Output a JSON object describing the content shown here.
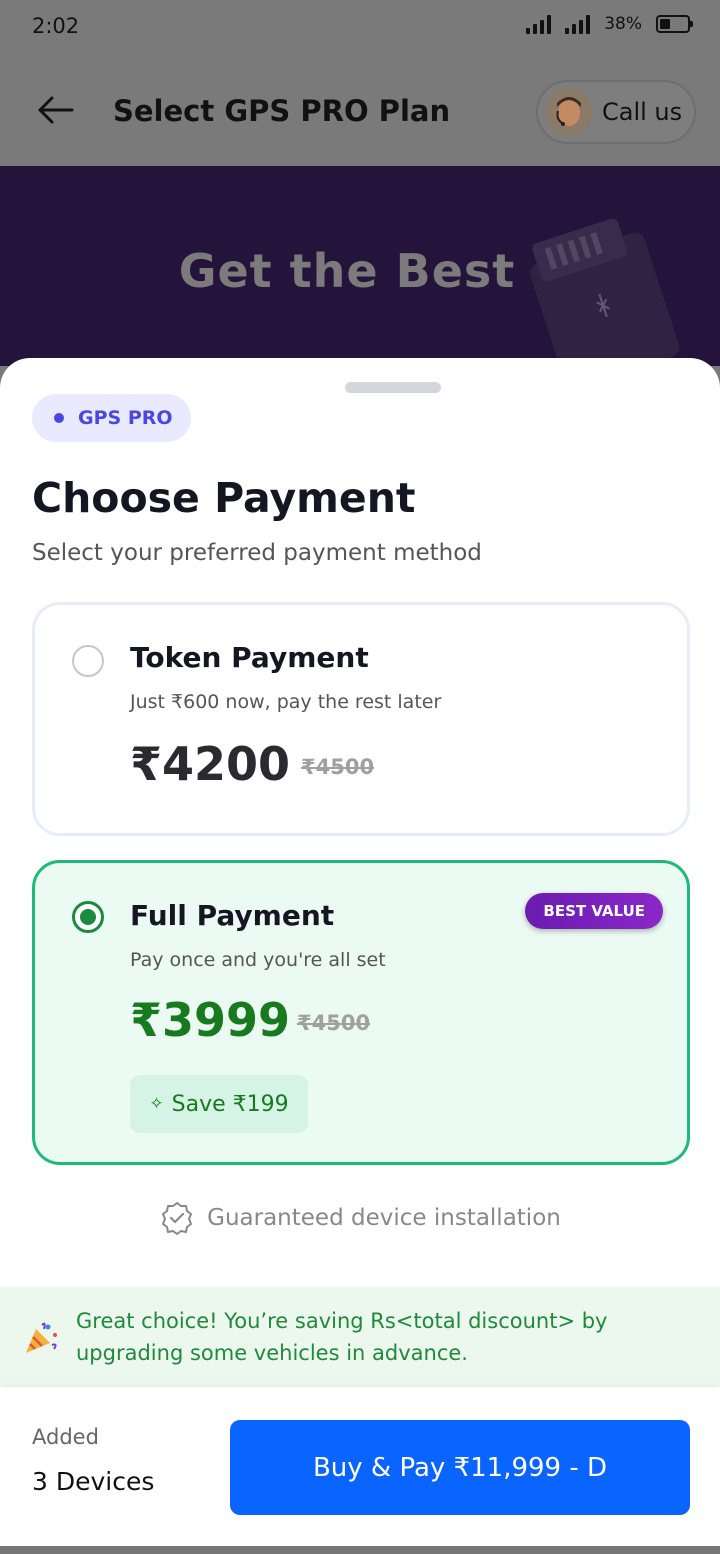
{
  "status_bar": {
    "time": "2:02",
    "battery": "38%"
  },
  "app_bar": {
    "title": "Select GPS PRO Plan",
    "call_label": "Call us"
  },
  "banner": {
    "headline": "Get the Best"
  },
  "sheet": {
    "chip_label": "GPS PRO",
    "title": "Choose Payment",
    "subtitle": "Select your preferred payment method",
    "options": [
      {
        "title": "Token Payment",
        "description": "Just ₹600 now, pay the rest later",
        "price": "₹4200",
        "original_price": "₹4500",
        "selected": false
      },
      {
        "title": "Full Payment",
        "description": "Pay once and you're all set",
        "price": "₹3999",
        "original_price": "₹4500",
        "badge": "BEST VALUE",
        "savings": "Save ₹199",
        "selected": true
      }
    ],
    "guarantee": "Guaranteed device installation",
    "notice": "Great choice! You’re saving Rs<total discount> by upgrading some vehicles in advance."
  },
  "footer": {
    "added_label": "Added",
    "devices": "3 Devices",
    "buy_label": "Buy & Pay ₹11,999 - D"
  },
  "colors": {
    "primary": "#0a64ff",
    "success": "#187a1f",
    "accent": "#4b47e0",
    "badge": "#7a22bd"
  }
}
